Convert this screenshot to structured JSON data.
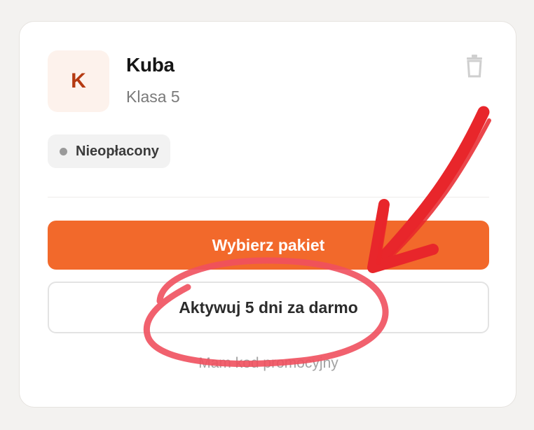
{
  "student": {
    "avatar_initial": "K",
    "name": "Kuba",
    "grade": "Klasa 5"
  },
  "status_badge": {
    "label": "Nieopłacony",
    "dot_color": "#9a9a9a"
  },
  "actions": {
    "primary_label": "Wybierz pakiet",
    "secondary_label": "Aktywuj 5 dni za darmo",
    "promo_link_label": "Mam kod promocyjny"
  },
  "icons": {
    "delete": "trash-icon"
  },
  "colors": {
    "accent": "#f2692b",
    "avatar_text": "#b53a12",
    "avatar_bg": "#fdf2ec",
    "annotation_arrow": "#e8262b",
    "annotation_circle": "#f0505e"
  }
}
